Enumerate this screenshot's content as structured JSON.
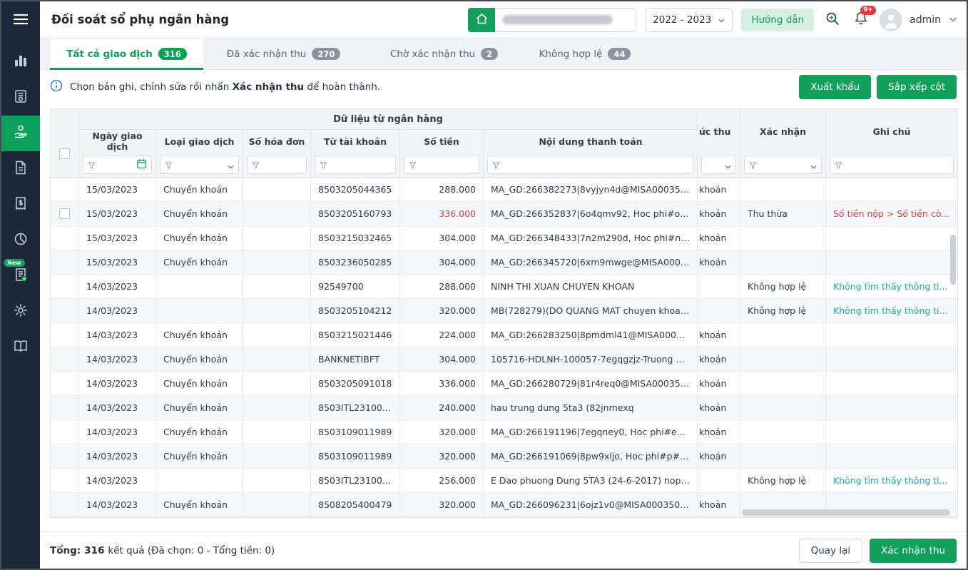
{
  "colors": {
    "primary_green": "#12a05a",
    "active_tab_green": "#00a651",
    "guide_button_bg": "#d5efe2",
    "error_red": "#e23b3b",
    "note_teal": "#0fb3a6",
    "sidebar_bg": "#1d2939"
  },
  "sidebar": {
    "items": [
      {
        "icon": "hamburger-menu"
      },
      {
        "icon": "bar-chart"
      },
      {
        "icon": "invoice-dollar"
      },
      {
        "icon": "hand-coin",
        "active": true
      },
      {
        "icon": "document"
      },
      {
        "icon": "receipt-dollar"
      },
      {
        "icon": "pie-chart"
      },
      {
        "icon": "contract-check",
        "badge": "New"
      },
      {
        "icon": "gear"
      },
      {
        "icon": "open-book"
      }
    ]
  },
  "header": {
    "title": "Đối soát sổ phụ ngân hàng",
    "year_select": "2022 - 2023",
    "guide_button": "Hướng dẫn",
    "notification_count": "9+",
    "username": "admin"
  },
  "tabs": [
    {
      "label": "Tất cả giao dịch",
      "count": "316",
      "active": true
    },
    {
      "label": "Đã xác nhận thu",
      "count": "270"
    },
    {
      "label": "Chờ xác nhận thu",
      "count": "2"
    },
    {
      "label": "Không hợp lệ",
      "count": "44"
    }
  ],
  "info_bar": {
    "message_prefix": "Chọn bản ghi, chỉnh sửa rồi nhấn ",
    "message_bold": "Xác nhận thu",
    "message_suffix": " để hoàn thành.",
    "export_button": "Xuất khẩu",
    "arrange_button": "Sắp xếp cột"
  },
  "table": {
    "group_header": "Dữ liệu từ ngân hàng",
    "columns": {
      "date": "Ngày giao dịch",
      "type": "Loại giao dịch",
      "invoice": "Số hóa đơn",
      "account": "Từ tài khoản",
      "amount": "Số tiền",
      "content": "Nội dung thanh toán",
      "method": "ức thu",
      "confirm": "Xác nhận",
      "note": "Ghi chú"
    },
    "rows": [
      {
        "date": "15/03/2023",
        "type": "Chuyển khoản",
        "invoice": "",
        "account": "8503205044365",
        "amount": "288.000",
        "content": "MA_GD:266382273|8vyjyn4d@MISA000350,...",
        "method": "khoản",
        "confirm": "",
        "note": ""
      },
      {
        "date": "15/03/2023",
        "type": "Chuyển khoản",
        "invoice": "",
        "account": "8503205160793",
        "amount": "336.000",
        "amount_color": "red",
        "content": "MA_GD:266352837|6o4qmv92, Hoc phi#o#[...",
        "method": "khoản",
        "confirm": "Thu thừa",
        "note": "Số tiền nộp > Số tiền cò...",
        "note_color": "red",
        "has_checkbox": true
      },
      {
        "date": "15/03/2023",
        "type": "Chuyển khoản",
        "invoice": "",
        "account": "8503215032465",
        "amount": "304.000",
        "content": "MA_GD:266348433|7n2m290d, Hoc phi#n#...",
        "method": "khoản",
        "confirm": "",
        "note": ""
      },
      {
        "date": "15/03/2023",
        "type": "Chuyển khoản",
        "invoice": "",
        "account": "8503236050285",
        "amount": "304.000",
        "content": "MA_GD:266345720|6xm9mwge@MISA0003...",
        "method": "khoản",
        "confirm": "",
        "note": ""
      },
      {
        "date": "14/03/2023",
        "type": "",
        "invoice": "",
        "account": "92549700",
        "amount": "288.000",
        "content": "NINH THI XUAN CHUYEN KHOAN",
        "method": "",
        "confirm": "Không hợp lệ",
        "note": "Không tìm thấy thông ti...",
        "note_color": "teal"
      },
      {
        "date": "14/03/2023",
        "type": "",
        "invoice": "",
        "account": "8503205104212",
        "amount": "320.000",
        "content": "MB(728279)(DO QUANG MAT chuyen khoan...",
        "method": "",
        "confirm": "Không hợp lệ",
        "note": "Không tìm thấy thông ti...",
        "note_color": "teal"
      },
      {
        "date": "14/03/2023",
        "type": "Chuyển khoản",
        "invoice": "",
        "account": "8503215021446",
        "amount": "224.000",
        "content": "MA_GD:266283250|8pmdml41@MISA00035...",
        "method": "khoản",
        "confirm": "",
        "note": ""
      },
      {
        "date": "14/03/2023",
        "type": "Chuyển khoản",
        "invoice": "",
        "account": "BANKNETIBFT",
        "amount": "304.000",
        "content": "105716-HDLNH-100057-7egqgzjz-Truong M...",
        "method": "khoản",
        "confirm": "",
        "note": ""
      },
      {
        "date": "14/03/2023",
        "type": "Chuyển khoản",
        "invoice": "",
        "account": "8503205091018",
        "amount": "336.000",
        "content": "MA_GD:266280729|81r4req0@MISA000350,...",
        "method": "khoản",
        "confirm": "",
        "note": ""
      },
      {
        "date": "14/03/2023",
        "type": "Chuyển khoản",
        "invoice": "",
        "account": "8503ITL23100...",
        "amount": "240.000",
        "content": "hau trung dung 5ta3 (82jnmexq",
        "method": "khoản",
        "confirm": "",
        "note": ""
      },
      {
        "date": "14/03/2023",
        "type": "Chuyển khoản",
        "invoice": "",
        "account": "8503109011989",
        "amount": "320.000",
        "content": "MA_GD:266191196|7egqney0, Hoc phi#e#[...",
        "method": "khoản",
        "confirm": "",
        "note": ""
      },
      {
        "date": "14/03/2023",
        "type": "Chuyển khoản",
        "invoice": "",
        "account": "8503109011989",
        "amount": "320.000",
        "content": "MA_GD:266191069|8pw9xljo, Hoc phi#p#[2...",
        "method": "khoản",
        "confirm": "",
        "note": ""
      },
      {
        "date": "14/03/2023",
        "type": "",
        "invoice": "",
        "account": "8503ITL23100...",
        "amount": "256.000",
        "content": "E Dao phuong Dung 5TA3 (24-6-2017) nop ti...",
        "method": "",
        "confirm": "Không hợp lệ",
        "note": "Không tìm thấy thông ti...",
        "note_color": "teal"
      },
      {
        "date": "14/03/2023",
        "type": "Chuyển khoản",
        "invoice": "",
        "account": "8508205400479",
        "amount": "320.000",
        "content": "MA_GD:266096231|6ojz1v0@MISA000350, ...",
        "method": "khoản",
        "confirm": "",
        "note": ""
      }
    ]
  },
  "footer": {
    "total_label": "Tổng:",
    "total_count": "316",
    "results_suffix": "kết quả (Đã chọn: 0 - Tổng tiền: 0)",
    "back_button": "Quay lại",
    "confirm_button": "Xác nhận thu"
  }
}
